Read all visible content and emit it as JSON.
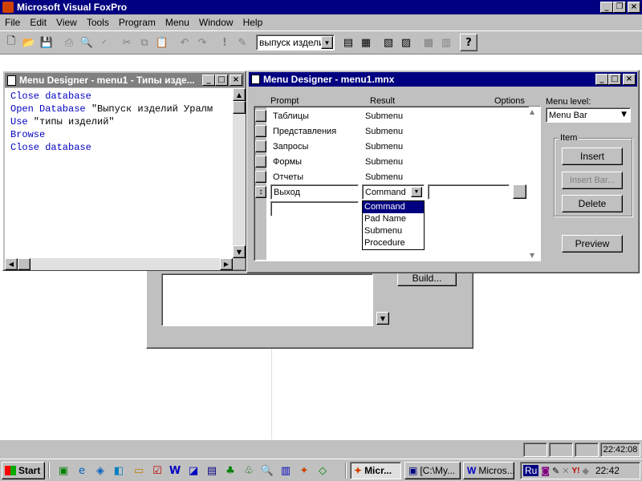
{
  "app": {
    "title": "Microsoft Visual FoxPro",
    "menu": [
      "File",
      "Edit",
      "View",
      "Tools",
      "Program",
      "Menu",
      "Window",
      "Help"
    ]
  },
  "toolbar": {
    "combo_value": "выпуск издели"
  },
  "code_window": {
    "title": "Menu Designer - menu1 - Типы изде...",
    "lines": [
      {
        "kw": "Close database",
        "rest": ""
      },
      {
        "kw": "Open Database",
        "rest": " \"Выпуск изделий Уралм"
      },
      {
        "kw": "Use",
        "rest": " \"типы изделий\""
      },
      {
        "kw": "Browse",
        "rest": ""
      },
      {
        "kw": "Close database",
        "rest": ""
      }
    ]
  },
  "menu_designer": {
    "title": "Menu Designer - menu1.mnx",
    "headers": {
      "prompt": "Prompt",
      "result": "Result",
      "options": "Options"
    },
    "rows": [
      {
        "prompt": "Таблицы",
        "result": "Submenu"
      },
      {
        "prompt": "Представления",
        "result": "Submenu"
      },
      {
        "prompt": "Запросы",
        "result": "Submenu"
      },
      {
        "prompt": "Формы",
        "result": "Submenu"
      },
      {
        "prompt": "Отчеты",
        "result": "Submenu"
      }
    ],
    "edit_row": {
      "prompt": "Выход",
      "result": "Command"
    },
    "dropdown_options": [
      "Command",
      "Pad Name",
      "Submenu",
      "Procedure"
    ],
    "selected_option": "Command",
    "menu_level_label": "Menu level:",
    "menu_level_value": "Menu Bar",
    "item_group_label": "Item",
    "buttons": {
      "insert": "Insert",
      "insert_bar": "Insert Bar...",
      "delete": "Delete",
      "preview": "Preview"
    }
  },
  "background_dialog": {
    "build_button": "Build..."
  },
  "statusbar": {
    "time": "22:42:08"
  },
  "taskbar": {
    "start": "Start",
    "tasks": [
      "Micr...",
      "[C:\\My...",
      "Micros..."
    ],
    "tray_lang": "Ru",
    "tray_time": "22:42"
  }
}
